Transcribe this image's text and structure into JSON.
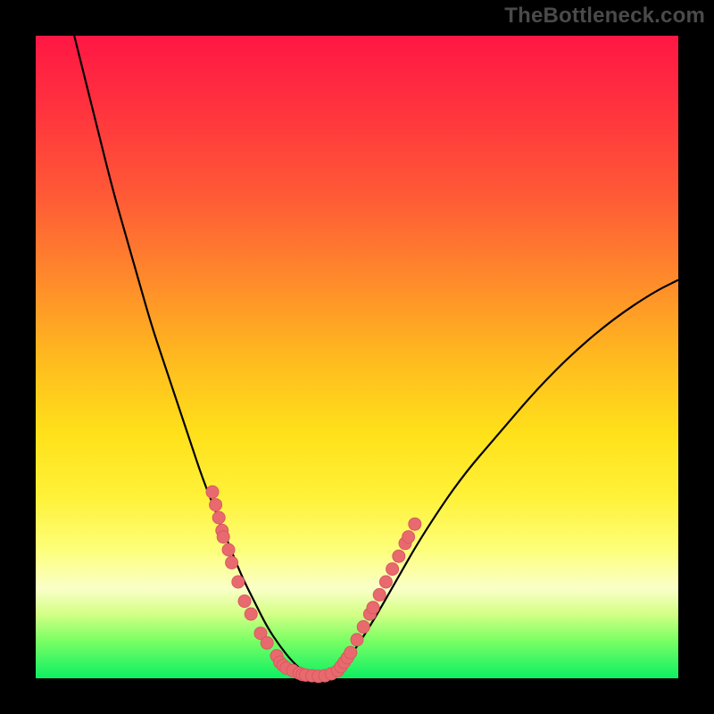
{
  "watermark": "TheBottleneck.com",
  "colors": {
    "frame": "#000000",
    "curve": "#000000",
    "marker_fill": "#e86a6f",
    "marker_stroke": "#d85a5f",
    "gradient_top": "#ff1744",
    "gradient_bottom": "#0cef63"
  },
  "chart_data": {
    "type": "line",
    "title": "",
    "xlabel": "",
    "ylabel": "",
    "xlim": [
      0,
      100
    ],
    "ylim": [
      0,
      100
    ],
    "grid": false,
    "curve": {
      "name": "bottleneck-curve",
      "x": [
        6,
        8,
        10,
        12,
        14,
        16,
        18,
        20,
        22,
        24,
        26,
        28,
        30,
        32,
        34,
        36,
        38,
        40,
        42,
        44,
        46,
        48,
        52,
        56,
        60,
        66,
        72,
        78,
        84,
        90,
        96,
        100
      ],
      "y": [
        100,
        92,
        84,
        76,
        69,
        62,
        55,
        49,
        43,
        37,
        31,
        26,
        21,
        16,
        12,
        8,
        5,
        2.5,
        0.8,
        0.2,
        0.5,
        2,
        8,
        15,
        22,
        31,
        38,
        45,
        51,
        56,
        60,
        62
      ]
    },
    "markers": [
      {
        "x": 27.5,
        "y": 29
      },
      {
        "x": 28.0,
        "y": 27
      },
      {
        "x": 28.5,
        "y": 25
      },
      {
        "x": 29.0,
        "y": 23
      },
      {
        "x": 29.2,
        "y": 22
      },
      {
        "x": 30.0,
        "y": 20
      },
      {
        "x": 30.5,
        "y": 18
      },
      {
        "x": 31.5,
        "y": 15
      },
      {
        "x": 32.5,
        "y": 12
      },
      {
        "x": 33.5,
        "y": 10
      },
      {
        "x": 35.0,
        "y": 7
      },
      {
        "x": 36.0,
        "y": 5.5
      },
      {
        "x": 37.5,
        "y": 3.5
      },
      {
        "x": 38.0,
        "y": 2.5
      },
      {
        "x": 38.5,
        "y": 2.0
      },
      {
        "x": 39.0,
        "y": 1.6
      },
      {
        "x": 40.0,
        "y": 1.2
      },
      {
        "x": 41.0,
        "y": 0.8
      },
      {
        "x": 41.5,
        "y": 0.6
      },
      {
        "x": 42.0,
        "y": 0.5
      },
      {
        "x": 43.0,
        "y": 0.4
      },
      {
        "x": 44.0,
        "y": 0.3
      },
      {
        "x": 45.0,
        "y": 0.4
      },
      {
        "x": 46.0,
        "y": 0.7
      },
      {
        "x": 47.0,
        "y": 1.2
      },
      {
        "x": 47.5,
        "y": 1.8
      },
      {
        "x": 48.0,
        "y": 2.5
      },
      {
        "x": 48.5,
        "y": 3.2
      },
      {
        "x": 49.0,
        "y": 4.0
      },
      {
        "x": 50.0,
        "y": 6.0
      },
      {
        "x": 51.0,
        "y": 8.0
      },
      {
        "x": 52.0,
        "y": 10.0
      },
      {
        "x": 52.5,
        "y": 11.0
      },
      {
        "x": 53.5,
        "y": 13.0
      },
      {
        "x": 54.5,
        "y": 15.0
      },
      {
        "x": 55.5,
        "y": 17.0
      },
      {
        "x": 56.5,
        "y": 19.0
      },
      {
        "x": 57.5,
        "y": 21.0
      },
      {
        "x": 58.0,
        "y": 22.0
      },
      {
        "x": 59.0,
        "y": 24.0
      }
    ]
  }
}
